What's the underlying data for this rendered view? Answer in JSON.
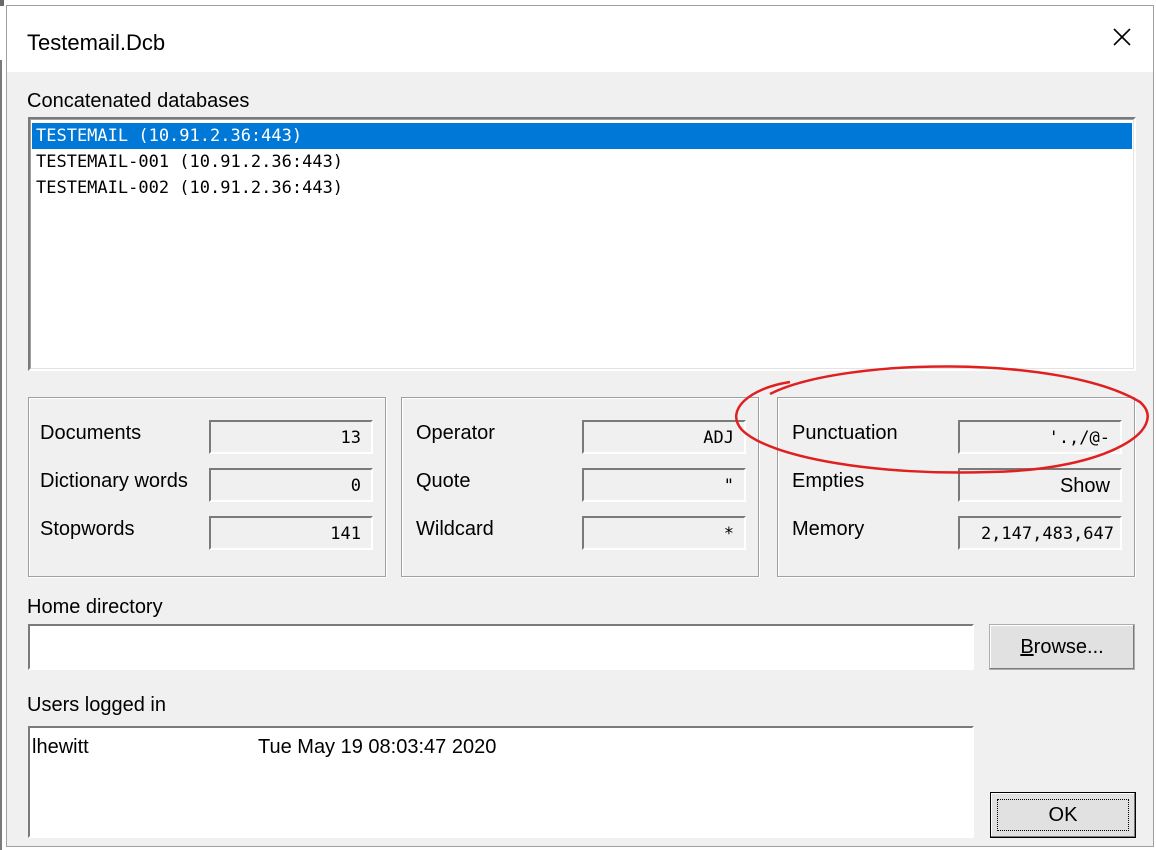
{
  "window": {
    "title": "Testemail.Dcb"
  },
  "concatenated": {
    "label": "Concatenated databases",
    "items": [
      "TESTEMAIL (10.91.2.36:443)",
      "TESTEMAIL-001 (10.91.2.36:443)",
      "TESTEMAIL-002 (10.91.2.36:443)"
    ],
    "selected_index": 0
  },
  "stats": {
    "documents_label": "Documents",
    "documents_value": "13",
    "dictionary_label": "Dictionary words",
    "dictionary_value": "0",
    "stopwords_label": "Stopwords",
    "stopwords_value": "141"
  },
  "search": {
    "operator_label": "Operator",
    "operator_value": "ADJ",
    "quote_label": "Quote",
    "quote_value": "\"",
    "wildcard_label": "Wildcard",
    "wildcard_value": "*"
  },
  "misc": {
    "punctuation_label": "Punctuation",
    "punctuation_value": "'.,/@-",
    "empties_label": "Empties",
    "empties_value": "Show",
    "memory_label": "Memory",
    "memory_value": "2,147,483,647"
  },
  "home": {
    "label": "Home directory",
    "value": "",
    "browse_prefix": "B",
    "browse_rest": "rowse..."
  },
  "users": {
    "label": "Users logged in",
    "rows": [
      {
        "name": "lhewitt",
        "time": "Tue May 19 08:03:47 2020"
      }
    ]
  },
  "buttons": {
    "ok_label": "OK"
  },
  "annotation": {
    "color": "#e02020"
  }
}
